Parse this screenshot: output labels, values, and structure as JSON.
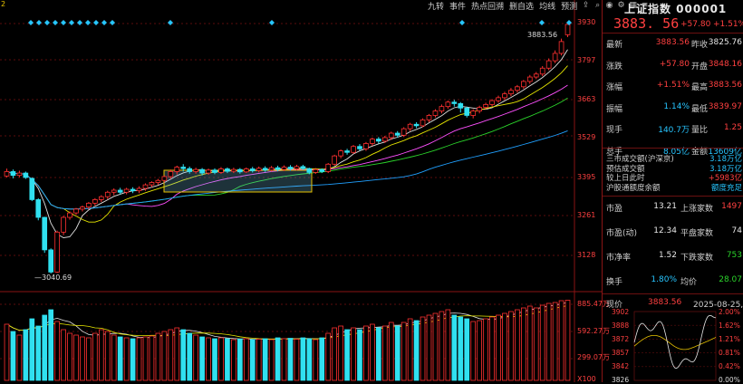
{
  "toolbar": {
    "buttons": [
      "九转",
      "事件",
      "热点回溯",
      "删自选",
      "均线",
      "预测"
    ],
    "icons": [
      "share-icon",
      "search-icon",
      "camera-icon",
      "gear-icon",
      "grid-icon",
      "menu-icon"
    ]
  },
  "header": {
    "title": "上证指数 000001",
    "price": "3883. 56",
    "change": "+57.80",
    "change_pct": "+1.51%"
  },
  "quote_rows": [
    {
      "l1": "最新",
      "v1": "3883.56",
      "c1": "red",
      "l2": "昨收",
      "v2": "3825.76",
      "c2": "white"
    },
    {
      "l1": "涨跌",
      "v1": "+57.80",
      "c1": "red",
      "l2": "开盘",
      "v2": "3848.16",
      "c2": "red"
    },
    {
      "l1": "涨幅",
      "v1": "+1.51%",
      "c1": "red",
      "l2": "最高",
      "v2": "3883.56",
      "c2": "red"
    },
    {
      "l1": "振幅",
      "v1": "1.14%",
      "c1": "blue",
      "l2": "最低",
      "v2": "3839.97",
      "c2": "red"
    },
    {
      "l1": "现手",
      "v1": "140.7万",
      "c1": "blue",
      "l2": "量比",
      "v2": "1.25",
      "c2": "red"
    },
    {
      "l1": "总手",
      "v1": "8.05亿",
      "c1": "blue",
      "l2": "金额",
      "v2": "13609亿",
      "c2": "blue"
    }
  ],
  "turnover": [
    {
      "label": "三市成交额(沪深京)",
      "value": "3.18万亿",
      "color": "blue"
    },
    {
      "label": "预估成交额",
      "value": "3.18万亿",
      "color": "blue"
    },
    {
      "label": "较上日此时",
      "value": "+5983亿",
      "color": "red"
    },
    {
      "label": "沪股通额度余额",
      "value": "额度充足",
      "color": "blue"
    }
  ],
  "stats": [
    {
      "l1": "市盈",
      "v1": "13.21",
      "l2": "上涨家数",
      "v2": "1497",
      "c2": "red"
    },
    {
      "l1": "市盈(动)",
      "v1": "12.34",
      "l2": "平盘家数",
      "v2": "74",
      "c2": "white"
    },
    {
      "l1": "市净率",
      "v1": "1.52",
      "l2": "下跌家数",
      "v2": "753",
      "c2": "green"
    },
    {
      "l1": "换手",
      "v1": "1.80%",
      "l2": "均价",
      "v2": "28.07",
      "c2": "green",
      "c1": "blue"
    }
  ],
  "mini_chart": {
    "label": "现价",
    "price": "3883.56",
    "date": "2025-08-25,一",
    "left_ticks": [
      "3902",
      "3888",
      "3872",
      "3857",
      "3842",
      "3826"
    ],
    "right_ticks": [
      "2.00%",
      "1.62%",
      "1.21%",
      "0.81%",
      "0.42%",
      "0.00%"
    ]
  },
  "price_axis": [
    "3930",
    "3797",
    "3663",
    "3529",
    "3395",
    "3261",
    "3128"
  ],
  "volume_axis": [
    "885.47万",
    "592.27万",
    "299.07万",
    "X100"
  ],
  "annotations": {
    "high_label": "3883.56",
    "low_label": "3040.69",
    "corner_mark": "2"
  },
  "colors": {
    "up": "#ff3030",
    "down": "#30e0f0",
    "ma5": "#e0e0e0",
    "ma10": "#e6e600",
    "ma20": "#ff50ff",
    "ma30": "#2bd42b",
    "ma60": "#20a0ff",
    "grid": "#7a1010"
  },
  "chart_data": {
    "type": "candlestick",
    "ylim": [
      3040,
      3935
    ],
    "candles": [
      [
        3370,
        3385,
        3395,
        3365
      ],
      [
        3385,
        3372,
        3392,
        3362
      ],
      [
        3372,
        3380,
        3388,
        3366
      ],
      [
        3380,
        3365,
        3385,
        3360
      ],
      [
        3362,
        3290,
        3365,
        3285
      ],
      [
        3290,
        3230,
        3295,
        3220
      ],
      [
        3230,
        3120,
        3232,
        3110
      ],
      [
        3120,
        3045,
        3125,
        3040
      ],
      [
        3045,
        3180,
        3185,
        3042
      ],
      [
        3180,
        3230,
        3235,
        3170
      ],
      [
        3230,
        3245,
        3250,
        3222
      ],
      [
        3245,
        3258,
        3262,
        3238
      ],
      [
        3258,
        3265,
        3270,
        3250
      ],
      [
        3265,
        3278,
        3282,
        3258
      ],
      [
        3278,
        3290,
        3295,
        3270
      ],
      [
        3290,
        3300,
        3305,
        3282
      ],
      [
        3300,
        3315,
        3320,
        3292
      ],
      [
        3315,
        3322,
        3328,
        3305
      ],
      [
        3322,
        3315,
        3330,
        3308
      ],
      [
        3315,
        3325,
        3330,
        3308
      ],
      [
        3325,
        3320,
        3332,
        3312
      ],
      [
        3320,
        3328,
        3335,
        3312
      ],
      [
        3328,
        3340,
        3345,
        3320
      ],
      [
        3340,
        3348,
        3352,
        3332
      ],
      [
        3348,
        3355,
        3360,
        3340
      ],
      [
        3355,
        3368,
        3372,
        3348
      ],
      [
        3368,
        3385,
        3392,
        3360
      ],
      [
        3385,
        3400,
        3405,
        3375
      ],
      [
        3400,
        3395,
        3410,
        3385
      ],
      [
        3395,
        3385,
        3402,
        3378
      ],
      [
        3385,
        3392,
        3398,
        3378
      ],
      [
        3392,
        3380,
        3397,
        3372
      ],
      [
        3380,
        3390,
        3395,
        3374
      ],
      [
        3390,
        3382,
        3396,
        3376
      ],
      [
        3382,
        3394,
        3400,
        3377
      ],
      [
        3394,
        3386,
        3399,
        3380
      ],
      [
        3386,
        3392,
        3398,
        3380
      ],
      [
        3392,
        3384,
        3397,
        3378
      ],
      [
        3384,
        3394,
        3399,
        3380
      ],
      [
        3394,
        3388,
        3401,
        3382
      ],
      [
        3388,
        3396,
        3402,
        3382
      ],
      [
        3396,
        3390,
        3403,
        3384
      ],
      [
        3390,
        3398,
        3404,
        3385
      ],
      [
        3398,
        3392,
        3405,
        3386
      ],
      [
        3392,
        3400,
        3406,
        3387
      ],
      [
        3400,
        3394,
        3407,
        3388
      ],
      [
        3394,
        3402,
        3408,
        3389
      ],
      [
        3402,
        3395,
        3408,
        3390
      ],
      [
        3395,
        3382,
        3398,
        3376
      ],
      [
        3382,
        3392,
        3397,
        3377
      ],
      [
        3392,
        3385,
        3396,
        3380
      ],
      [
        3385,
        3410,
        3414,
        3380
      ],
      [
        3410,
        3438,
        3442,
        3405
      ],
      [
        3438,
        3455,
        3460,
        3430
      ],
      [
        3455,
        3450,
        3462,
        3442
      ],
      [
        3450,
        3470,
        3475,
        3445
      ],
      [
        3470,
        3462,
        3478,
        3455
      ],
      [
        3462,
        3480,
        3485,
        3455
      ],
      [
        3480,
        3495,
        3500,
        3472
      ],
      [
        3495,
        3488,
        3502,
        3480
      ],
      [
        3488,
        3500,
        3506,
        3482
      ],
      [
        3500,
        3515,
        3520,
        3492
      ],
      [
        3515,
        3508,
        3522,
        3500
      ],
      [
        3508,
        3530,
        3535,
        3502
      ],
      [
        3530,
        3545,
        3550,
        3522
      ],
      [
        3545,
        3540,
        3552,
        3532
      ],
      [
        3540,
        3560,
        3565,
        3535
      ],
      [
        3560,
        3575,
        3580,
        3552
      ],
      [
        3575,
        3590,
        3596,
        3568
      ],
      [
        3590,
        3605,
        3612,
        3582
      ],
      [
        3605,
        3620,
        3625,
        3598
      ],
      [
        3620,
        3615,
        3628,
        3605
      ],
      [
        3615,
        3600,
        3620,
        3585
      ],
      [
        3600,
        3575,
        3605,
        3568
      ],
      [
        3575,
        3590,
        3596,
        3565
      ],
      [
        3590,
        3602,
        3608,
        3582
      ],
      [
        3602,
        3612,
        3618,
        3595
      ],
      [
        3612,
        3625,
        3630,
        3605
      ],
      [
        3625,
        3635,
        3642,
        3618
      ],
      [
        3635,
        3648,
        3655,
        3628
      ],
      [
        3648,
        3660,
        3668,
        3640
      ],
      [
        3660,
        3672,
        3678,
        3652
      ],
      [
        3672,
        3690,
        3695,
        3665
      ],
      [
        3690,
        3705,
        3712,
        3682
      ],
      [
        3705,
        3715,
        3722,
        3698
      ],
      [
        3715,
        3735,
        3742,
        3708
      ],
      [
        3735,
        3760,
        3768,
        3728
      ],
      [
        3760,
        3785,
        3795,
        3752
      ],
      [
        3785,
        3825,
        3835,
        3778
      ],
      [
        3848,
        3883,
        3884,
        3840
      ]
    ],
    "volumes": [
      620,
      540,
      500,
      560,
      680,
      600,
      720,
      780,
      650,
      560,
      520,
      500,
      480,
      470,
      520,
      560,
      540,
      500,
      480,
      470,
      460,
      470,
      480,
      490,
      520,
      540,
      560,
      580,
      560,
      520,
      500,
      480,
      470,
      460,
      470,
      460,
      450,
      455,
      460,
      450,
      455,
      460,
      450,
      470,
      460,
      465,
      455,
      470,
      460,
      450,
      470,
      520,
      580,
      600,
      560,
      580,
      560,
      600,
      620,
      580,
      600,
      640,
      600,
      640,
      680,
      660,
      700,
      720,
      740,
      760,
      780,
      720,
      700,
      680,
      650,
      660,
      680,
      700,
      720,
      740,
      760,
      780,
      800,
      820,
      800,
      830,
      850,
      860,
      880,
      885
    ]
  }
}
